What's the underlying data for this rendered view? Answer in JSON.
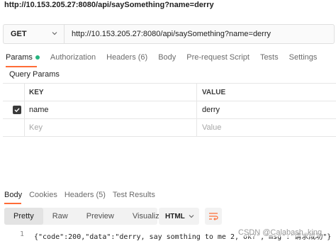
{
  "title_url": "http://10.153.205.27:8080/api/saySomething?name=derry",
  "request": {
    "method": "GET",
    "url": "http://10.153.205.27:8080/api/saySomething?name=derry"
  },
  "tabs": [
    {
      "label": "Params"
    },
    {
      "label": "Authorization"
    },
    {
      "label": "Headers (6)"
    },
    {
      "label": "Body"
    },
    {
      "label": "Pre-request Script"
    },
    {
      "label": "Tests"
    },
    {
      "label": "Settings"
    }
  ],
  "query_params_title": "Query Params",
  "table": {
    "key_header": "KEY",
    "value_header": "VALUE",
    "rows": [
      {
        "key": "name",
        "value": "derry",
        "checked": true
      }
    ],
    "key_placeholder": "Key",
    "value_placeholder": "Value"
  },
  "response_tabs": [
    {
      "label": "Body"
    },
    {
      "label": "Cookies"
    },
    {
      "label": "Headers (5)"
    },
    {
      "label": "Test Results"
    }
  ],
  "view_modes": [
    {
      "label": "Pretty"
    },
    {
      "label": "Raw"
    },
    {
      "label": "Preview"
    },
    {
      "label": "Visualize"
    }
  ],
  "format": "HTML",
  "code": {
    "line_number": "1",
    "text": "{\"code\":200,\"data\":\"derry, say somthing to me 2, ok?\",\"msg\":\"请求成功\"}"
  },
  "watermark": "CSDN @Calabash_king",
  "colors": {
    "accent": "#ff6c37",
    "dot": "#26b47f"
  }
}
